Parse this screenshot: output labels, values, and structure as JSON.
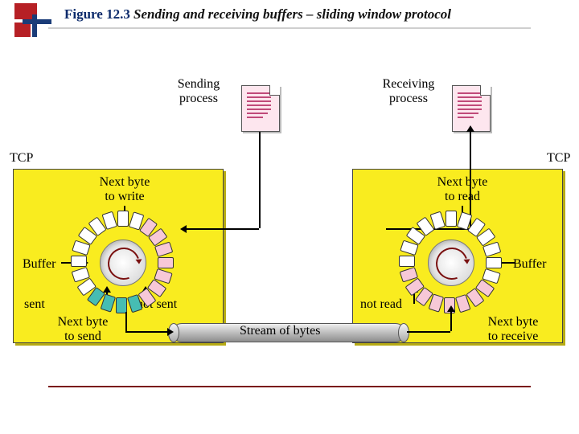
{
  "header": {
    "figure_no": "Figure 12.3",
    "title": "Sending and receiving buffers – sliding window protocol"
  },
  "processes": {
    "sending": "Sending\nprocess",
    "receiving": "Receiving\nprocess"
  },
  "tcp": {
    "left_label": "TCP",
    "right_label": "TCP"
  },
  "sending_side": {
    "next_write": "Next byte\nto write",
    "buffer_label": "Buffer",
    "sent": "sent",
    "not_sent": "not sent",
    "next_send": "Next byte\nto send"
  },
  "receiving_side": {
    "next_read": "Next byte\nto read",
    "buffer_label": "Buffer",
    "not_read": "not read",
    "next_receive": "Next byte\nto receive"
  },
  "stream_label": "Stream of bytes",
  "colors": {
    "panel": "#f9ec1f",
    "doc_fill": "#fde6ee",
    "teal": "#46bdb3",
    "pink": "#f7c8d7",
    "accent_blue": "#0b2a6b"
  }
}
